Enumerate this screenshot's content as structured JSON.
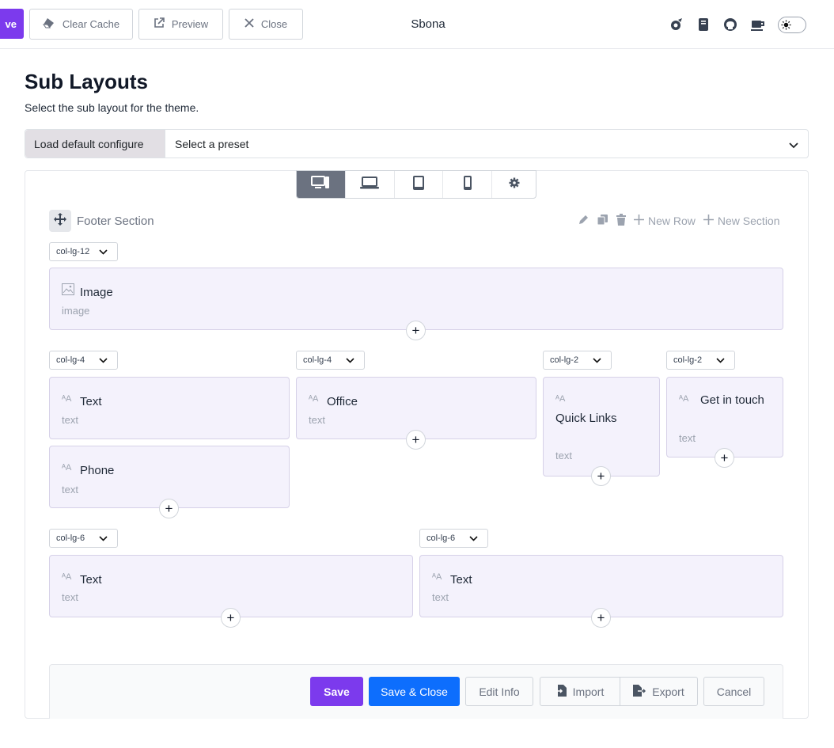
{
  "topbar": {
    "save_label": "ve",
    "clear_cache_label": "Clear Cache",
    "preview_label": "Preview",
    "close_label": "Close",
    "title": "Sbona",
    "icons": [
      "rocket-icon",
      "book-icon",
      "github-icon",
      "coffee-icon",
      "sun-icon"
    ]
  },
  "page": {
    "heading": "Sub Layouts",
    "description": "Select the sub layout for the theme."
  },
  "preset": {
    "load_label": "Load default configure",
    "select_value": "Select a preset"
  },
  "devices": [
    "desktop",
    "laptop",
    "tablet",
    "mobile",
    "settings"
  ],
  "section": {
    "title": "Footer Section",
    "new_row_label": "New Row",
    "new_section_label": "New Section"
  },
  "rows": [
    {
      "columns": [
        {
          "col_class": "col-lg-12",
          "addons": [
            {
              "title": "Image",
              "type": "image"
            }
          ]
        }
      ]
    },
    {
      "columns": [
        {
          "col_class": "col-lg-4",
          "addons": [
            {
              "title": "Text",
              "type": "text"
            },
            {
              "title": "Phone",
              "type": "text"
            }
          ]
        },
        {
          "col_class": "col-lg-4",
          "addons": [
            {
              "title": "Office",
              "type": "text"
            }
          ]
        },
        {
          "col_class": "col-lg-2",
          "addons": [
            {
              "title": "Quick Links",
              "type": "text"
            }
          ]
        },
        {
          "col_class": "col-lg-2",
          "addons": [
            {
              "title": "Get in touch",
              "type": "text"
            }
          ]
        }
      ]
    },
    {
      "columns": [
        {
          "col_class": "col-lg-6",
          "addons": [
            {
              "title": "Text",
              "type": "text"
            }
          ]
        },
        {
          "col_class": "col-lg-6",
          "addons": [
            {
              "title": "Text",
              "type": "text"
            }
          ]
        }
      ]
    }
  ],
  "footer": {
    "save_label": "Save",
    "save_close_label": "Save & Close",
    "edit_info_label": "Edit Info",
    "import_label": "Import",
    "export_label": "Export",
    "cancel_label": "Cancel"
  },
  "colors": {
    "primary_purple": "#7c3aed",
    "primary_blue": "#0d6efd",
    "card_bg": "#f4f2fc"
  }
}
